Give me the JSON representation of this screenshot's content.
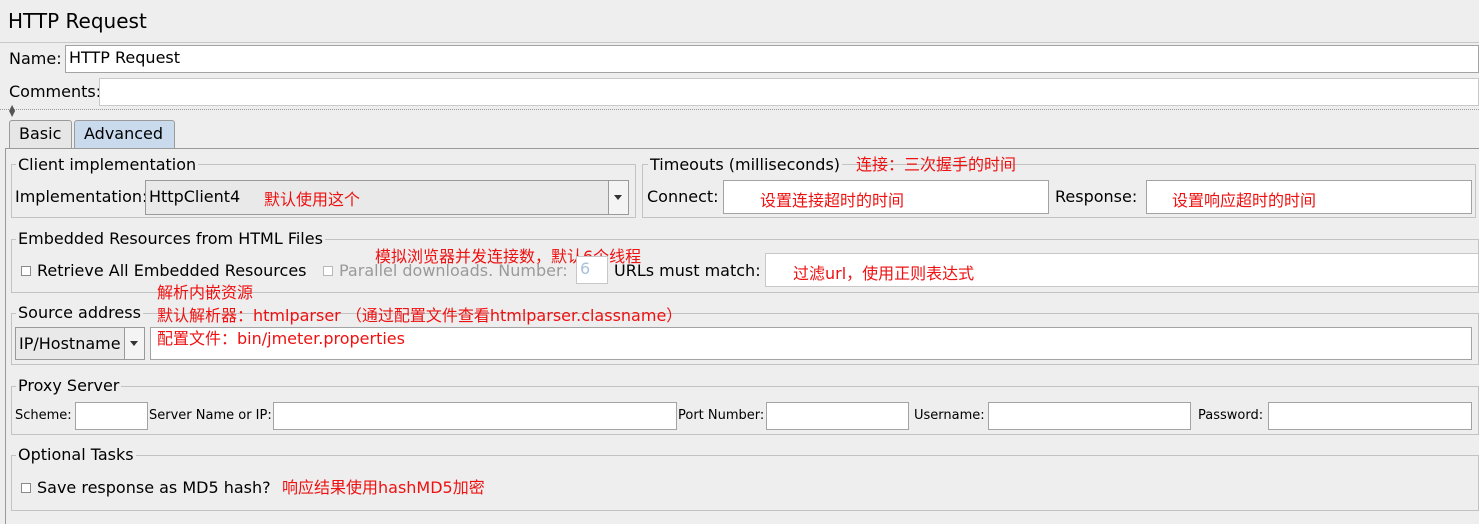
{
  "panel": {
    "title": "HTTP Request"
  },
  "name_field": {
    "label": "Name:",
    "value": "HTTP Request"
  },
  "comments_field": {
    "label": "Comments:",
    "value": ""
  },
  "tabs": [
    {
      "label": "Basic"
    },
    {
      "label": "Advanced",
      "active": true
    }
  ],
  "client_impl": {
    "legend": "Client implementation",
    "impl_label": "Implementation:",
    "impl_value": "HttpClient4",
    "note": "默认使用这个"
  },
  "timeouts": {
    "legend": "Timeouts (milliseconds)",
    "note": "连接：三次握手的时间",
    "connect_label": "Connect:",
    "connect_note": "设置连接超时的时间",
    "response_label": "Response:",
    "response_note": "设置响应超时的时间"
  },
  "embedded": {
    "legend": "Embedded Resources from HTML Files",
    "retrieve_label": "Retrieve All Embedded Resources",
    "parallel_label": "Parallel downloads. Number:",
    "parallel_value": "6",
    "urls_label": "URLs must match:",
    "note_parallel": "模拟浏览器并发连接数，默认6个线程",
    "note_urls": "过滤url，使用正则表达式",
    "note_parse": "解析内嵌资源"
  },
  "source_address": {
    "legend": "Source address",
    "type_value": "IP/Hostname",
    "value": "",
    "note_parser": "默认解析器：htmlparser    （通过配置文件查看htmlparser.classname）",
    "note_config": "配置文件：bin/jmeter.properties"
  },
  "proxy": {
    "legend": "Proxy Server",
    "scheme_label": "Scheme:",
    "server_label": "Server Name or IP:",
    "port_label": "Port Number:",
    "username_label": "Username:",
    "password_label": "Password:"
  },
  "optional": {
    "legend": "Optional Tasks",
    "md5_label": "Save response as MD5 hash?",
    "note": "响应结果使用hashMD5加密"
  },
  "colors": {
    "annotation": "#ee1111",
    "active_tab": "#c8daec",
    "background": "#eeeeee"
  },
  "icons": [
    "collapse-arrows-icon",
    "dropdown-arrow-icon",
    "checkbox-icon"
  ]
}
